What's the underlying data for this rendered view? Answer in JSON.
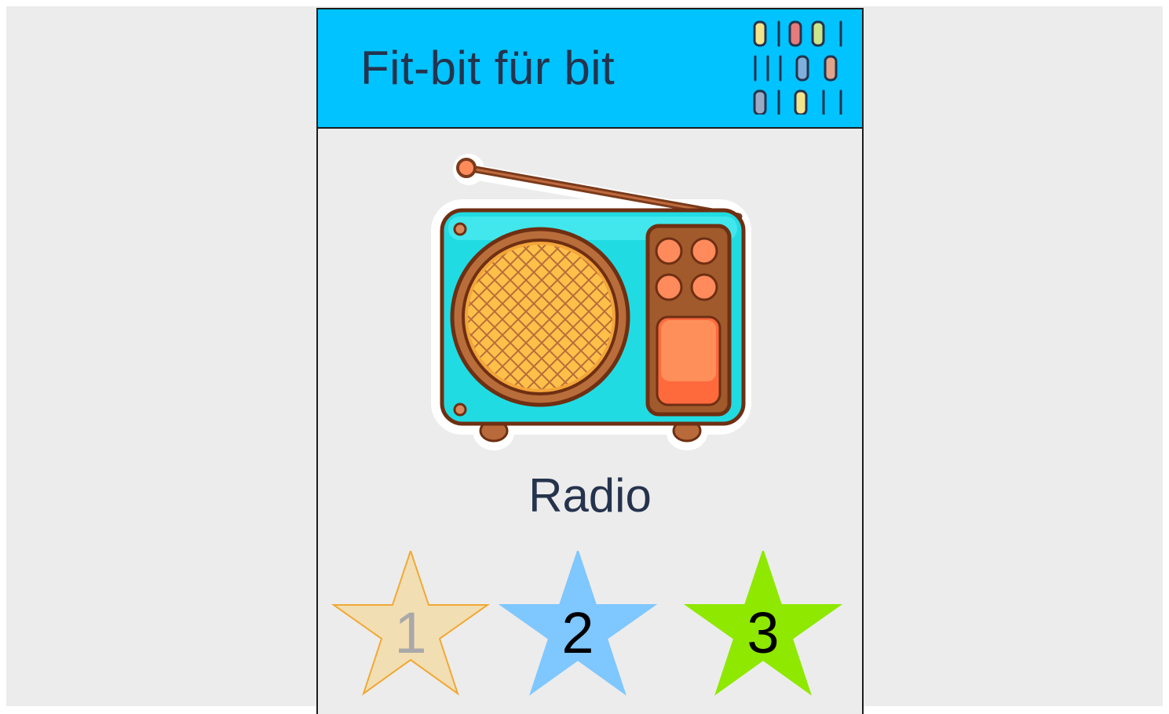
{
  "header": {
    "title": "Fit-bit für bit",
    "logo_icon": "color-bits-grid-icon",
    "logo_colors": [
      "#f2e48a",
      "#e57b7b",
      "#c9e68a",
      "#7fb0dc",
      "#e0a48a",
      "#9aaac4",
      "#f2e48a"
    ]
  },
  "item": {
    "image_icon": "radio-icon",
    "label": "Radio"
  },
  "levels": [
    {
      "number": "1",
      "fill": "#f2deb3",
      "stroke": "#f0a935",
      "text_color": "#a9a9a9",
      "state": "dimmed"
    },
    {
      "number": "2",
      "fill": "#7fc7ff",
      "stroke": "#7fc7ff",
      "text_color": "#000000",
      "state": "active"
    },
    {
      "number": "3",
      "fill": "#8fe800",
      "stroke": "#8fe800",
      "text_color": "#000000",
      "state": "active"
    }
  ],
  "colors": {
    "header_bg": "#00c3ff",
    "page_bg": "#ececec",
    "text": "#25334d"
  }
}
